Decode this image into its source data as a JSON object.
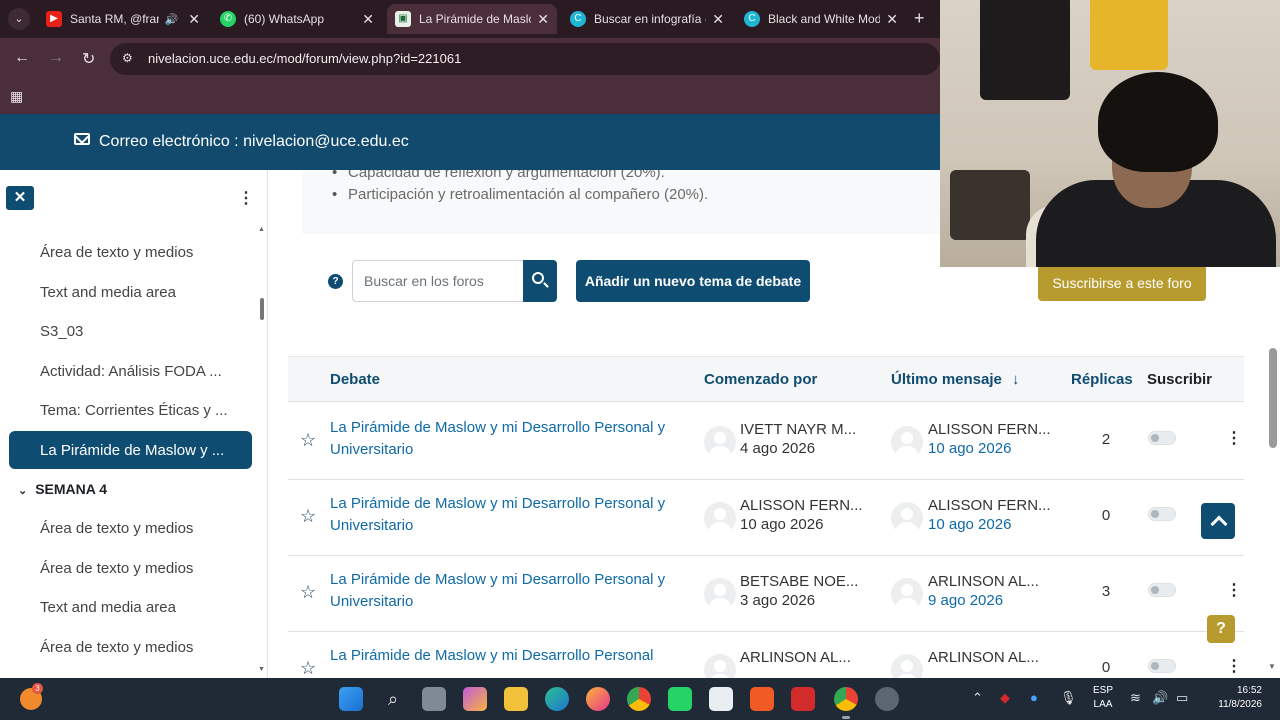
{
  "browser": {
    "tabs": [
      {
        "title": "Santa RM, @franc",
        "active": false
      },
      {
        "title": "(60) WhatsApp",
        "active": false
      },
      {
        "title": "La Pirámide de Maslo",
        "active": true
      },
      {
        "title": "Buscar en infografía -",
        "active": false
      },
      {
        "title": "Black and White Mod",
        "active": false
      }
    ],
    "url": "nivelacion.uce.edu.ec/mod/forum/view.php?id=221061"
  },
  "header": {
    "contact": "Correo electrónico : nivelacion@uce.edu.ec"
  },
  "sidebar": {
    "items": [
      {
        "label": "Área de texto y medios"
      },
      {
        "label": "Text and media area"
      },
      {
        "label": "S3_03"
      },
      {
        "label": "Actividad: Análisis FODA ..."
      },
      {
        "label": "Tema: Corrientes Éticas y ..."
      },
      {
        "label": "La Pirámide de Maslow y ..."
      }
    ],
    "section": "SEMANA 4",
    "section_items": [
      {
        "label": "Área de texto y medios"
      },
      {
        "label": "Área de texto y medios"
      },
      {
        "label": "Text and media area"
      },
      {
        "label": "Área de texto y medios"
      }
    ]
  },
  "content": {
    "bullets": [
      "Capacidad de reflexión y argumentación (20%).",
      "Participación y retroalimentación al compañero (20%)."
    ],
    "search_placeholder": "Buscar en los foros",
    "add_topic": "Añadir un nuevo tema de debate",
    "subscribe": "Suscribirse a este foro"
  },
  "table": {
    "headers": {
      "debate": "Debate",
      "started_by": "Comenzado por",
      "last_post": "Último mensaje",
      "last_post_sort_icon": "arrow-down",
      "replies": "Réplicas",
      "subscribe": "Suscribir"
    },
    "rows": [
      {
        "title": "La Pirámide de Maslow y mi Desarrollo Personal y Universitario",
        "author": "IVETT NAYR M...",
        "author_date": "4 ago 2026",
        "last_author": "ALISSON FERN...",
        "last_date": "10 ago 2026",
        "replies": "2"
      },
      {
        "title": "La Pirámide de Maslow y mi Desarrollo Personal y Universitario",
        "author": "ALISSON FERN...",
        "author_date": "10 ago 2026",
        "last_author": "ALISSON FERN...",
        "last_date": "10 ago 2026",
        "replies": "0"
      },
      {
        "title": "La Pirámide de Maslow y mi Desarrollo Personal y Universitario",
        "author": "BETSABE NOE...",
        "author_date": "3 ago 2026",
        "last_author": "ARLINSON AL...",
        "last_date": "9 ago 2026",
        "replies": "3"
      },
      {
        "title": "La Pirámide de Maslow y mi Desarrollo Personal",
        "author": "ARLINSON AL...",
        "author_date": "",
        "last_author": "ARLINSON AL...",
        "last_date": "",
        "replies": "0"
      }
    ]
  },
  "taskbar": {
    "notification_count": "3",
    "lang_top": "ESP",
    "lang_bottom": "LAA",
    "time": "16:52",
    "date": "11/8/2026"
  },
  "colors": {
    "primary": "#0f4c72",
    "link": "#0f6aa8",
    "accent": "#b89b2e",
    "browser_frame": "#4a2f3b",
    "taskbar": "#1f2a36"
  }
}
